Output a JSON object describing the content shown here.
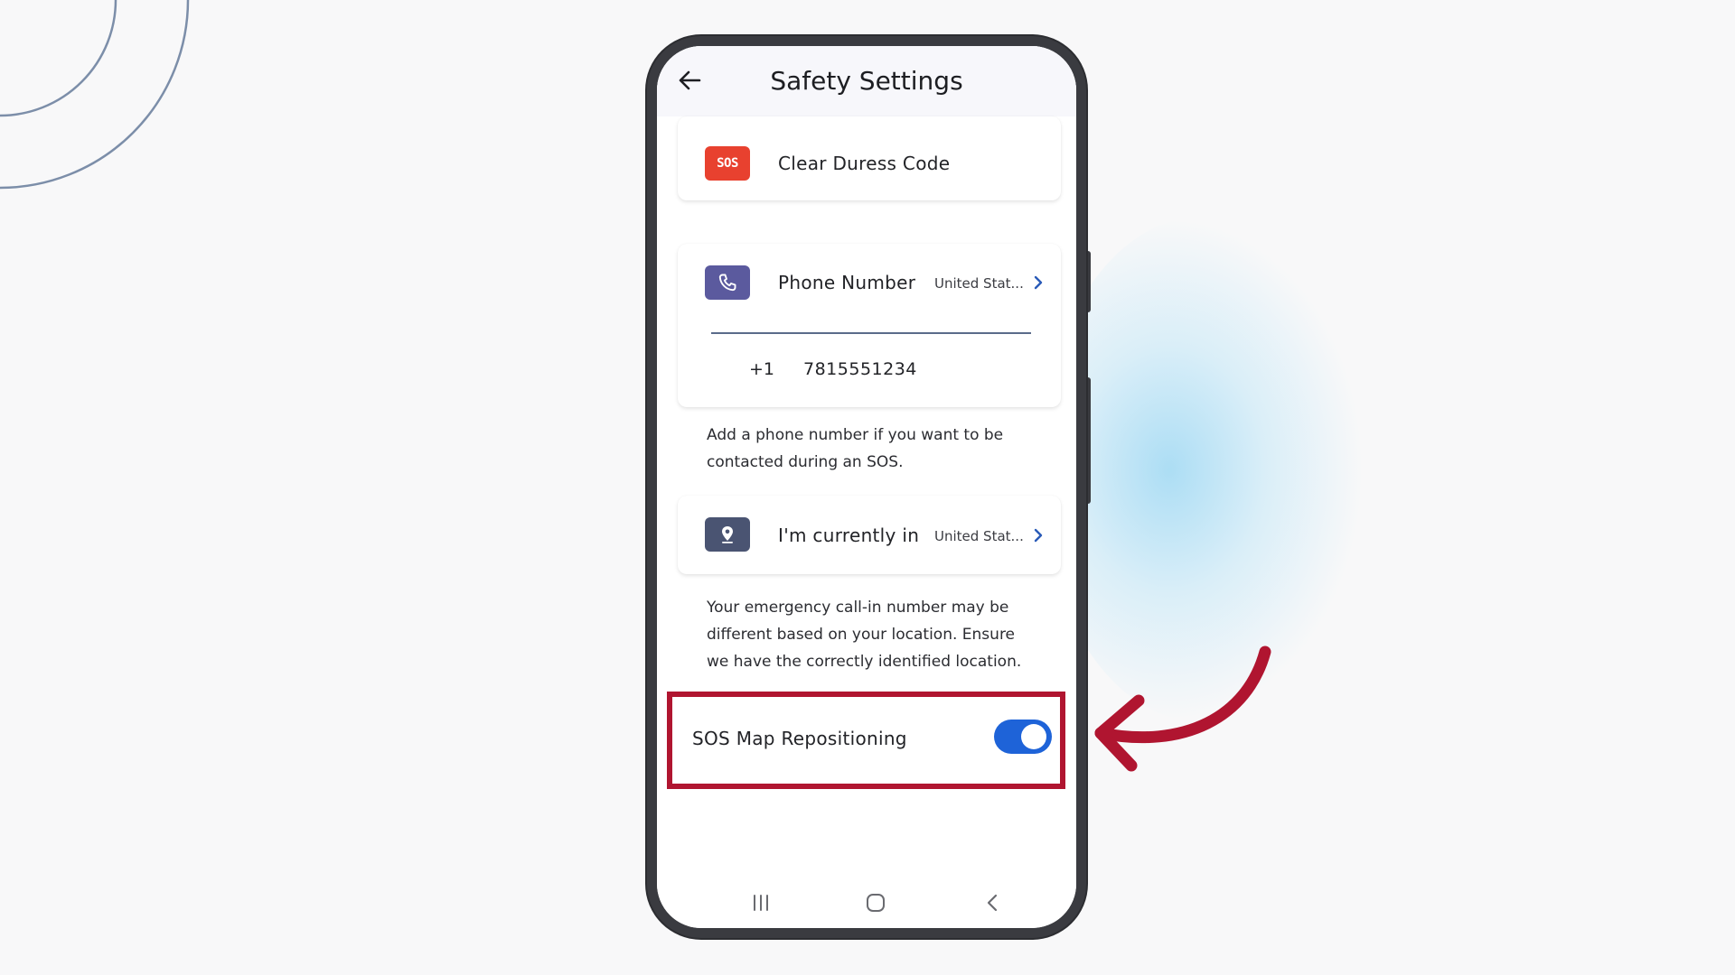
{
  "header": {
    "title": "Safety Settings"
  },
  "duress": {
    "icon_text": "SOS",
    "label": "Clear Duress Code"
  },
  "phone": {
    "label": "Phone Number",
    "country": "United Stat...",
    "country_code": "+1",
    "number": "7815551234",
    "help": "Add a phone number if you want to be contacted during an SOS."
  },
  "location": {
    "label": "I'm currently in",
    "country": "United Stat...",
    "help": "Your emergency call-in number may be different based on your location. Ensure we have the correctly identified location."
  },
  "sos_map": {
    "label": "SOS Map Repositioning",
    "enabled": true
  },
  "colors": {
    "sos_icon": "#e8412f",
    "phone_icon": "#5b5a9e",
    "location_icon": "#4a5472",
    "toggle_on": "#1e63d8",
    "highlight": "#b01530",
    "chevron": "#2a5bb8"
  },
  "icons": {
    "back": "arrow-left-icon",
    "phone": "phone-icon",
    "location": "map-pin-icon",
    "chevron": "chevron-right-icon",
    "nav_recents": "recents-icon",
    "nav_home": "home-icon",
    "nav_back": "nav-back-icon"
  }
}
